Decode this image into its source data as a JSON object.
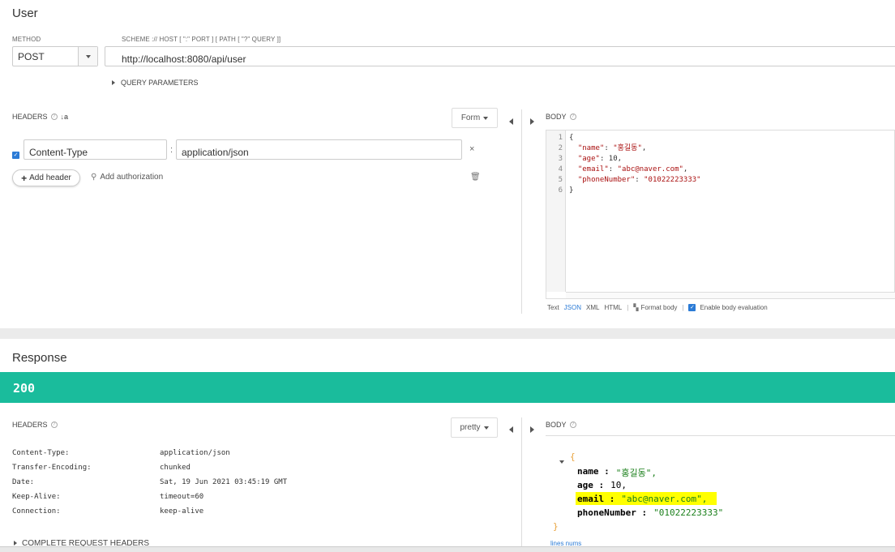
{
  "request": {
    "title": "User",
    "method_label": "METHOD",
    "method_value": "POST",
    "url_label": "SCHEME :// HOST [ \":\" PORT ] [ PATH [ \"?\" QUERY ]]",
    "url_value": "http://localhost:8080/api/user",
    "query_params_label": "QUERY PARAMETERS",
    "headers_label": "HEADERS",
    "headers_mode": "Form",
    "header_rows": [
      {
        "enabled": true,
        "name": "Content-Type",
        "value": "application/json"
      }
    ],
    "add_header_label": "Add header",
    "add_authorization_label": "Add authorization",
    "body_label": "BODY",
    "body_lines": [
      "1",
      "2",
      "3",
      "4",
      "5",
      "6"
    ],
    "body_format": {
      "text": "Text",
      "json": "JSON",
      "xml": "XML",
      "html": "HTML",
      "format_body": "Format body",
      "enable_eval": "Enable body evaluation"
    }
  },
  "response": {
    "title": "Response",
    "status": "200",
    "status_color": "#1abc9c",
    "headers_label": "HEADERS",
    "headers_mode": "pretty",
    "headers": [
      {
        "name": "Content-Type:",
        "value": "application/json"
      },
      {
        "name": "Transfer-Encoding:",
        "value": "chunked"
      },
      {
        "name": "Date:",
        "value": "Sat, 19 Jun 2021 03:45:19 GMT"
      },
      {
        "name": "Keep-Alive:",
        "value": "timeout=60"
      },
      {
        "name": "Connection:",
        "value": "keep-alive"
      }
    ],
    "complete_request_headers": "COMPLETE REQUEST HEADERS",
    "body_label": "BODY",
    "body_json": {
      "name_key": "name :",
      "name_val": "\"홍길동\",",
      "age_key": "age :",
      "age_val": "10,",
      "email_key": "email :",
      "email_val": "\"abc@naver.com\",",
      "phone_key": "phoneNumber :",
      "phone_val": "\"01022223333\""
    },
    "lines_nums": "lines nums",
    "highlight_color": "#ffff00"
  }
}
